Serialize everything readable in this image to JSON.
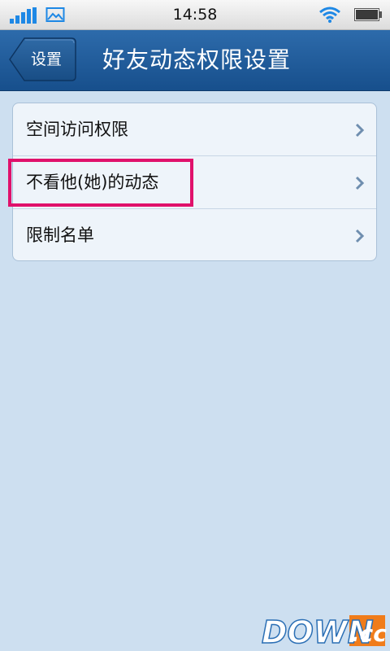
{
  "status_bar": {
    "time": "14:58"
  },
  "header": {
    "back_label": "设置",
    "title": "好友动态权限设置"
  },
  "menu": {
    "items": [
      {
        "label": "空间访问权限"
      },
      {
        "label": "不看他(她)的动态"
      },
      {
        "label": "限制名单"
      }
    ]
  },
  "watermark": {
    "text": "DOWN.cc"
  },
  "colors": {
    "title_bar": "#1f5c9c",
    "background": "#cddff0",
    "highlight": "#e0116b",
    "accent": "#1e88e5"
  }
}
